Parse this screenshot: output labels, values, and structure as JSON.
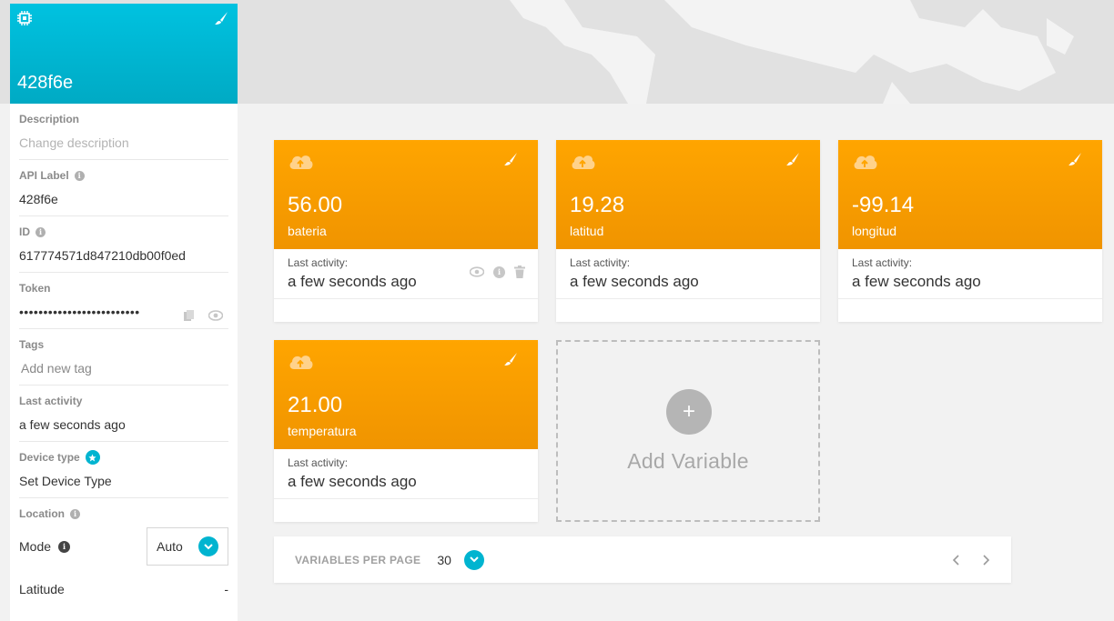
{
  "device": {
    "name": "428f6e",
    "fields": {
      "description": {
        "label": "Description",
        "placeholder": "Change description"
      },
      "api_label": {
        "label": "API Label",
        "value": "428f6e"
      },
      "id": {
        "label": "ID",
        "value": "617774571d847210db00f0ed"
      },
      "token": {
        "label": "Token",
        "value": "•••••••••••••••••••••••••"
      },
      "tags": {
        "label": "Tags",
        "placeholder": "Add new tag"
      },
      "last_activity": {
        "label": "Last activity",
        "value": "a few seconds ago"
      },
      "device_type": {
        "label": "Device type",
        "value": "Set Device Type"
      },
      "location": {
        "label": "Location"
      }
    },
    "mode": {
      "label": "Mode",
      "value": "Auto"
    },
    "latitude": {
      "label": "Latitude",
      "value": "-"
    }
  },
  "variables": [
    {
      "value": "56.00",
      "name": "bateria",
      "last_activity_label": "Last activity:",
      "last_activity": "a few seconds ago"
    },
    {
      "value": "19.28",
      "name": "latitud",
      "last_activity_label": "Last activity:",
      "last_activity": "a few seconds ago"
    },
    {
      "value": "-99.14",
      "name": "longitud",
      "last_activity_label": "Last activity:",
      "last_activity": "a few seconds ago"
    },
    {
      "value": "21.00",
      "name": "temperatura",
      "last_activity_label": "Last activity:",
      "last_activity": "a few seconds ago"
    }
  ],
  "add_variable": {
    "plus": "+",
    "label": "Add Variable"
  },
  "pagination": {
    "label": "VARIABLES PER PAGE",
    "value": "30"
  },
  "icons": {
    "info": "i",
    "chip": "chip-icon",
    "brush": "brush-icon",
    "cloud": "cloud-upload-icon",
    "eye": "eye-icon",
    "trash": "trash-icon",
    "copy": "copy-icon"
  },
  "colors": {
    "device_header": "#00b8d4",
    "variable_card": "#ffa000",
    "accent": "#00b4d0"
  }
}
